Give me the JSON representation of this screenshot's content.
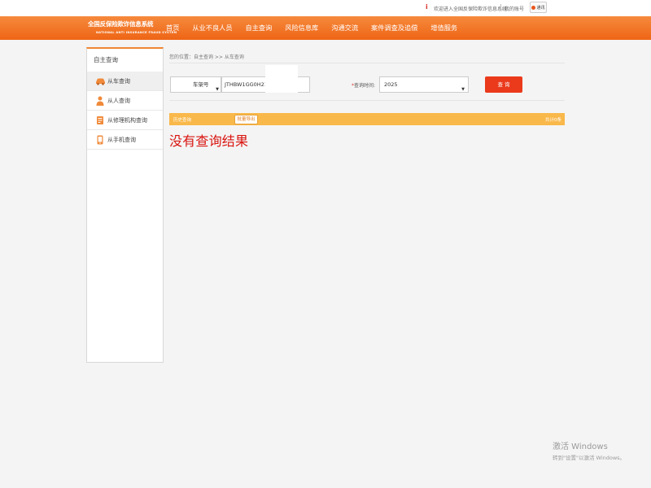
{
  "topbar": {
    "welcome": "欢迎进入全国反保险欺诈信息系统",
    "my_account": "我的账号",
    "notify_label": "通讯"
  },
  "logo": {
    "cn": "全国反保险欺诈信息系统",
    "en": "NATIONAL ANTI INSURANCE FRAUD SYSTEM"
  },
  "nav": {
    "items": [
      "首页",
      "从业不良人员",
      "自主查询",
      "风险信息库",
      "沟通交流",
      "案件调查及追偿",
      "增值服务"
    ]
  },
  "sidebar": {
    "title": "自主查询",
    "items": [
      {
        "label": "从车查询",
        "icon": "car-icon"
      },
      {
        "label": "从人查询",
        "icon": "person-icon"
      },
      {
        "label": "从修理机构查询",
        "icon": "repair-shop-icon"
      },
      {
        "label": "从手机查询",
        "icon": "phone-icon"
      }
    ]
  },
  "breadcrumb": "您的位置：自主查询 >> 从车查询",
  "search": {
    "type_value": "车架号",
    "vin_value": "JTHBW1GG0H2171",
    "time_label": "查询时间:",
    "year_value": "2025",
    "query_button": "查 询"
  },
  "result": {
    "left_label": "历史查询",
    "export_button": "批量导出",
    "right_label": "共计0条",
    "no_result": "没有查询结果"
  },
  "os_watermark": {
    "line1": "激活 Windows",
    "line2": "转到\"设置\"以激活 Windows。"
  },
  "colors": {
    "brand_orange": "#ee6515",
    "query_red": "#ea3a1b",
    "result_bar": "#f9b84a",
    "no_result_red": "#d9140f"
  }
}
